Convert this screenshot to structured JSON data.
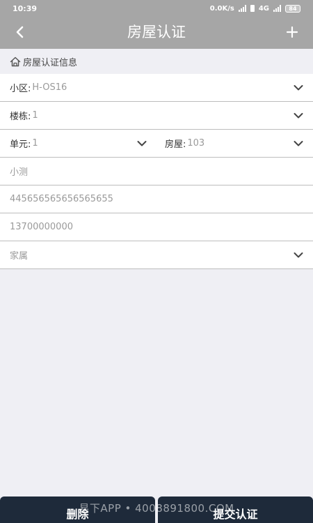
{
  "status_bar": {
    "time": "10:39",
    "network_speed": "0.0K/s",
    "network_type": "4G",
    "battery": "84"
  },
  "nav": {
    "title": "房屋认证",
    "back_icon": "chevron-left-icon",
    "add_icon": "plus-icon"
  },
  "section": {
    "title": "房屋认证信息",
    "icon": "home-icon"
  },
  "form": {
    "community": {
      "label": "小区:",
      "value": "H-OS16"
    },
    "building": {
      "label": "楼栋:",
      "value": "1"
    },
    "unit": {
      "label": "单元:",
      "value": "1"
    },
    "house": {
      "label": "房屋:",
      "value": "103"
    },
    "name": {
      "value": "小测"
    },
    "id_number": {
      "value": "445656565656565655"
    },
    "phone": {
      "value": "13700000000"
    },
    "relation": {
      "value": "家属"
    }
  },
  "buttons": {
    "delete_label": "删除",
    "submit_label": "提交认证"
  },
  "watermark": "易下APP • 4008891800.COM",
  "colors": {
    "header_bg": "#a6a6a6",
    "button_bg": "#1e2a3a",
    "page_bg": "#efeff4"
  }
}
